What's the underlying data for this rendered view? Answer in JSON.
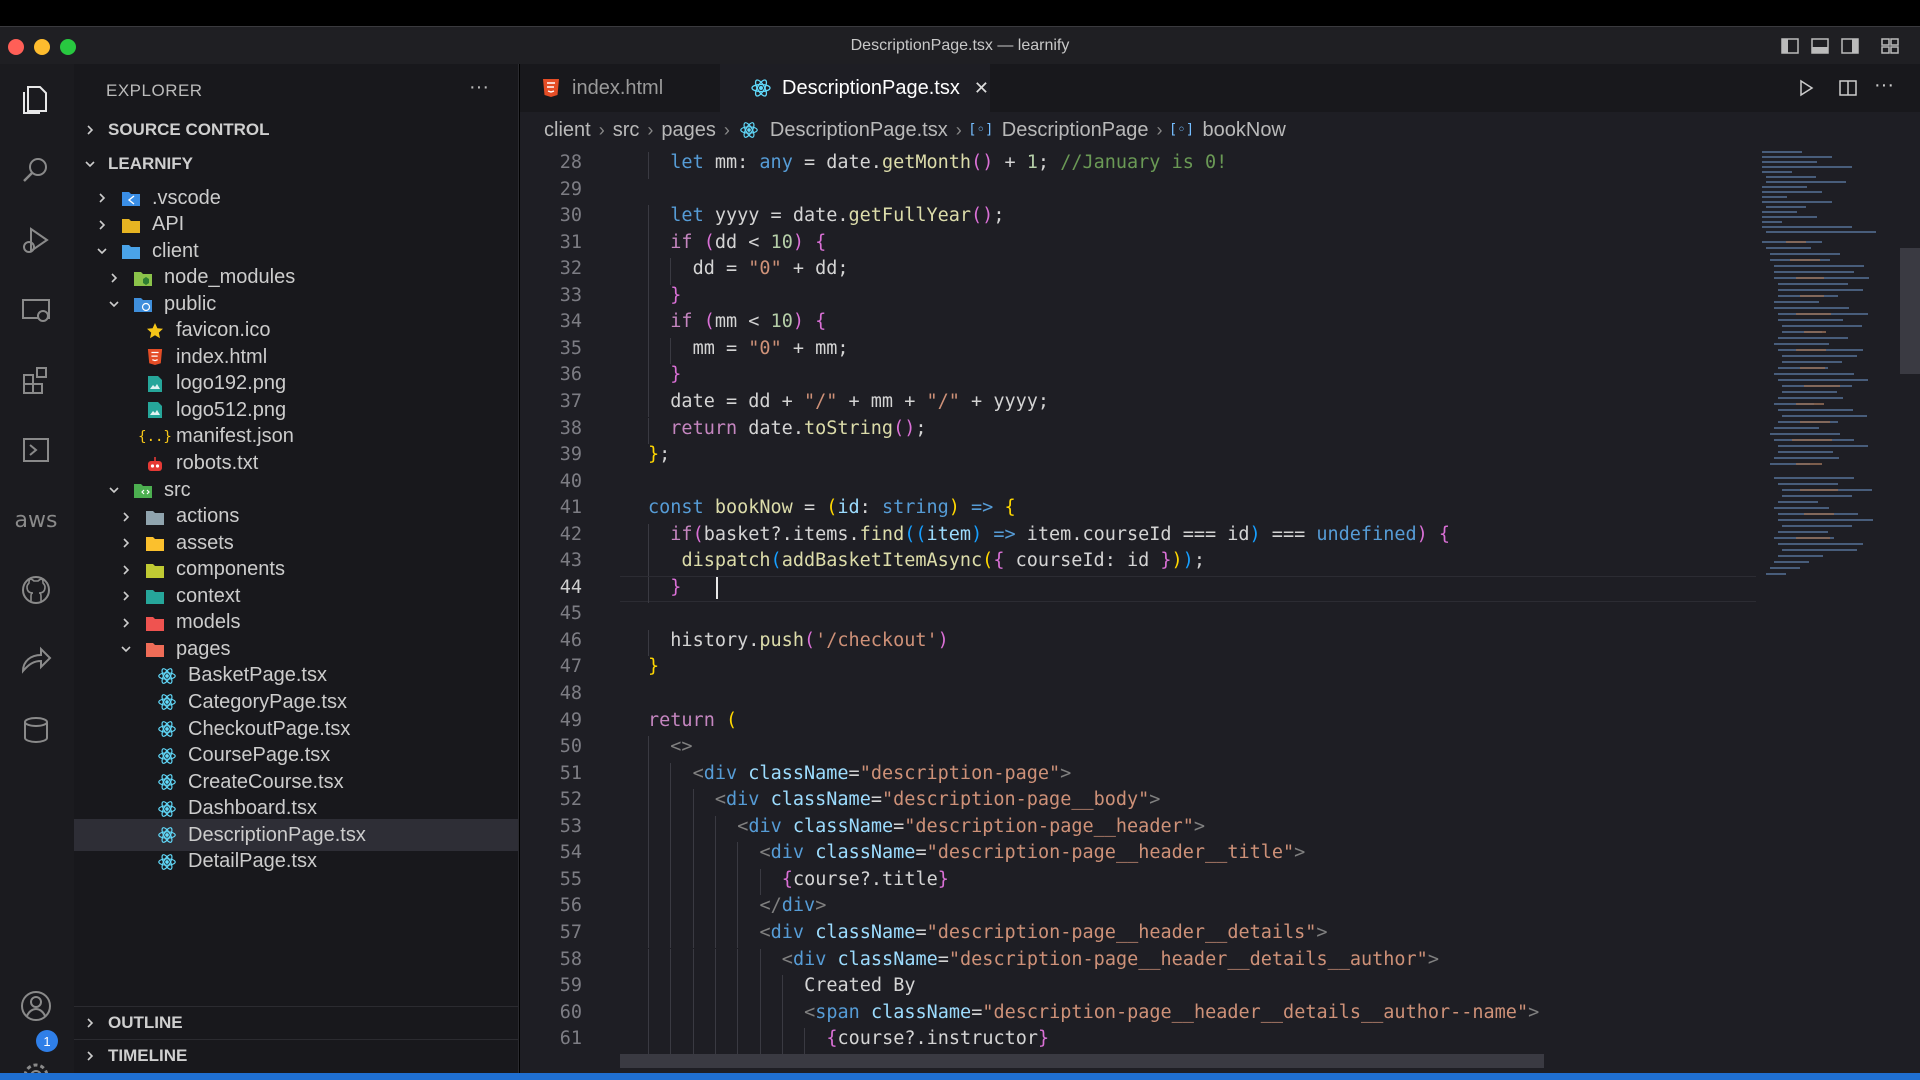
{
  "window": {
    "title": "DescriptionPage.tsx — learnify"
  },
  "colors": {
    "accent": "#1f6fd1",
    "close": "#ff5f57",
    "minimize": "#febc2e",
    "maximize": "#28c840"
  },
  "activity_bar": {
    "items": [
      "explorer-icon",
      "search-icon",
      "run-debug-icon",
      "remote-explorer-icon",
      "extensions-icon",
      "terminal-icon",
      "aws-icon",
      "github-icon",
      "live-share-icon",
      "database-icon"
    ],
    "aws_label": "aws",
    "accounts_badge": "1"
  },
  "sidebar": {
    "header": "EXPLORER",
    "more": "···",
    "sections": {
      "source_control": "SOURCE CONTROL",
      "project": "LEARNIFY",
      "outline": "OUTLINE",
      "timeline": "TIMELINE"
    },
    "tree": [
      {
        "label": ".vscode",
        "icon": "vscode-folder-icon",
        "expanded": false
      },
      {
        "label": "API",
        "icon": "folder-icon",
        "expanded": false
      },
      {
        "label": "client",
        "icon": "folder-open-icon",
        "expanded": true
      },
      {
        "label": "node_modules",
        "icon": "node-folder-icon",
        "expanded": false
      },
      {
        "label": "public",
        "icon": "public-folder-icon",
        "expanded": true
      },
      {
        "label": "favicon.ico",
        "icon": "star-icon"
      },
      {
        "label": "index.html",
        "icon": "html5-icon"
      },
      {
        "label": "logo192.png",
        "icon": "image-icon"
      },
      {
        "label": "logo512.png",
        "icon": "image-icon"
      },
      {
        "label": "manifest.json",
        "icon": "json-icon"
      },
      {
        "label": "robots.txt",
        "icon": "robot-icon"
      },
      {
        "label": "src",
        "icon": "src-folder-icon",
        "expanded": true
      },
      {
        "label": "actions",
        "icon": "folder-icon",
        "expanded": false
      },
      {
        "label": "assets",
        "icon": "folder-icon",
        "expanded": false
      },
      {
        "label": "components",
        "icon": "folder-icon",
        "expanded": false
      },
      {
        "label": "context",
        "icon": "folder-icon",
        "expanded": false
      },
      {
        "label": "models",
        "icon": "folder-icon",
        "expanded": false
      },
      {
        "label": "pages",
        "icon": "folder-open-icon",
        "expanded": true
      },
      {
        "label": "BasketPage.tsx",
        "icon": "react-icon"
      },
      {
        "label": "CategoryPage.tsx",
        "icon": "react-icon"
      },
      {
        "label": "CheckoutPage.tsx",
        "icon": "react-icon"
      },
      {
        "label": "CoursePage.tsx",
        "icon": "react-icon"
      },
      {
        "label": "CreateCourse.tsx",
        "icon": "react-icon"
      },
      {
        "label": "Dashboard.tsx",
        "icon": "react-icon"
      },
      {
        "label": "DescriptionPage.tsx",
        "icon": "react-icon",
        "selected": true
      },
      {
        "label": "DetailPage.tsx",
        "icon": "react-icon"
      }
    ]
  },
  "tabs": [
    {
      "label": "index.html",
      "icon": "html5-icon",
      "active": false
    },
    {
      "label": "DescriptionPage.tsx",
      "icon": "react-icon",
      "active": true,
      "close": "✕"
    }
  ],
  "breadcrumb": [
    "client",
    "src",
    "pages",
    "DescriptionPage.tsx",
    "DescriptionPage",
    "bookNow"
  ],
  "editor": {
    "current_line": 44,
    "lines": [
      {
        "n": "28",
        "indent": 1,
        "tokens": [
          [
            "k",
            "let"
          ],
          [
            "p",
            " mm: "
          ],
          [
            "t",
            "any"
          ],
          [
            "p",
            " = date."
          ],
          [
            "f",
            "getMonth"
          ],
          [
            "b2",
            "()"
          ],
          [
            "p",
            " + "
          ],
          [
            "n",
            "1"
          ],
          [
            "p",
            "; "
          ],
          [
            "c",
            "//January is 0!"
          ]
        ]
      },
      {
        "n": "29",
        "indent": 0,
        "tokens": []
      },
      {
        "n": "30",
        "indent": 1,
        "tokens": [
          [
            "k",
            "let"
          ],
          [
            "p",
            " yyyy = date."
          ],
          [
            "f",
            "getFullYear"
          ],
          [
            "b2",
            "()"
          ],
          [
            "p",
            ";"
          ]
        ]
      },
      {
        "n": "31",
        "indent": 1,
        "tokens": [
          [
            "kc",
            "if"
          ],
          [
            "p",
            " "
          ],
          [
            "b2",
            "("
          ],
          [
            "p",
            "dd < "
          ],
          [
            "n",
            "10"
          ],
          [
            "b2",
            ")"
          ],
          [
            "p",
            " "
          ],
          [
            "b2",
            "{"
          ]
        ]
      },
      {
        "n": "32",
        "indent": 2,
        "tokens": [
          [
            "p",
            "dd = "
          ],
          [
            "s",
            "\"0\""
          ],
          [
            "p",
            " + dd;"
          ]
        ]
      },
      {
        "n": "33",
        "indent": 1,
        "tokens": [
          [
            "b2",
            "}"
          ]
        ]
      },
      {
        "n": "34",
        "indent": 1,
        "tokens": [
          [
            "kc",
            "if"
          ],
          [
            "p",
            " "
          ],
          [
            "b2",
            "("
          ],
          [
            "p",
            "mm < "
          ],
          [
            "n",
            "10"
          ],
          [
            "b2",
            ")"
          ],
          [
            "p",
            " "
          ],
          [
            "b2",
            "{"
          ]
        ]
      },
      {
        "n": "35",
        "indent": 2,
        "tokens": [
          [
            "p",
            "mm = "
          ],
          [
            "s",
            "\"0\""
          ],
          [
            "p",
            " + mm;"
          ]
        ]
      },
      {
        "n": "36",
        "indent": 1,
        "tokens": [
          [
            "b2",
            "}"
          ]
        ]
      },
      {
        "n": "37",
        "indent": 1,
        "tokens": [
          [
            "p",
            "date = dd + "
          ],
          [
            "s",
            "\"/\""
          ],
          [
            "p",
            " + mm + "
          ],
          [
            "s",
            "\"/\""
          ],
          [
            "p",
            " + yyyy;"
          ]
        ]
      },
      {
        "n": "38",
        "indent": 1,
        "tokens": [
          [
            "kc",
            "return"
          ],
          [
            "p",
            " date."
          ],
          [
            "f",
            "toString"
          ],
          [
            "b2",
            "()"
          ],
          [
            "p",
            ";"
          ]
        ]
      },
      {
        "n": "39",
        "indent": 0,
        "tokens": [
          [
            "b1",
            "}"
          ],
          [
            "p",
            ";"
          ]
        ]
      },
      {
        "n": "40",
        "indent": 0,
        "tokens": []
      },
      {
        "n": "41",
        "indent": 0,
        "tokens": [
          [
            "k",
            "const"
          ],
          [
            "p",
            " "
          ],
          [
            "f",
            "bookNow"
          ],
          [
            "p",
            " = "
          ],
          [
            "b1",
            "("
          ],
          [
            "a",
            "id"
          ],
          [
            "p",
            ": "
          ],
          [
            "t",
            "string"
          ],
          [
            "b1",
            ")"
          ],
          [
            "p",
            " "
          ],
          [
            "k",
            "=>"
          ],
          [
            "p",
            " "
          ],
          [
            "b1",
            "{"
          ]
        ]
      },
      {
        "n": "42",
        "indent": 1,
        "tokens": [
          [
            "kc",
            "if"
          ],
          [
            "b2",
            "("
          ],
          [
            "p",
            "basket?.items."
          ],
          [
            "f",
            "find"
          ],
          [
            "b3",
            "(("
          ],
          [
            "a",
            "item"
          ],
          [
            "b3",
            ")"
          ],
          [
            "p",
            " "
          ],
          [
            "k",
            "=>"
          ],
          [
            "p",
            " item.courseId === id"
          ],
          [
            "b3",
            ")"
          ],
          [
            "p",
            " === "
          ],
          [
            "k",
            "undefined"
          ],
          [
            "b2",
            ")"
          ],
          [
            "p",
            " "
          ],
          [
            "b2",
            "{"
          ]
        ]
      },
      {
        "n": "43",
        "indent": 1,
        "tokens": [
          [
            "p",
            " "
          ],
          [
            "f",
            "dispatch"
          ],
          [
            "b3",
            "("
          ],
          [
            "f",
            "addBasketItemAsync"
          ],
          [
            "b1",
            "("
          ],
          [
            "b2",
            "{"
          ],
          [
            "p",
            " courseId: id "
          ],
          [
            "b2",
            "}"
          ],
          [
            "b1",
            ")"
          ],
          [
            "b3",
            ")"
          ],
          [
            "p",
            ";"
          ]
        ]
      },
      {
        "n": "44",
        "indent": 1,
        "tokens": [
          [
            "b2",
            "}"
          ]
        ]
      },
      {
        "n": "45",
        "indent": 0,
        "tokens": []
      },
      {
        "n": "46",
        "indent": 1,
        "tokens": [
          [
            "p",
            "history."
          ],
          [
            "f",
            "push"
          ],
          [
            "b2",
            "("
          ],
          [
            "s",
            "'/checkout'"
          ],
          [
            "b2",
            ")"
          ]
        ]
      },
      {
        "n": "47",
        "indent": 0,
        "tokens": [
          [
            "b1",
            "}"
          ]
        ]
      },
      {
        "n": "48",
        "indent": 0,
        "tokens": []
      },
      {
        "n": "49",
        "indent": 0,
        "tokens": [
          [
            "kc",
            "return"
          ],
          [
            "p",
            " "
          ],
          [
            "b1",
            "("
          ]
        ]
      },
      {
        "n": "50",
        "indent": 1,
        "tokens": [
          [
            "tbr",
            "<>"
          ]
        ]
      },
      {
        "n": "51",
        "indent": 2,
        "tokens": [
          [
            "tbr",
            "<"
          ],
          [
            "tag",
            "div"
          ],
          [
            "p",
            " "
          ],
          [
            "a",
            "className"
          ],
          [
            "p",
            "="
          ],
          [
            "s",
            "\"description-page\""
          ],
          [
            "tbr",
            ">"
          ]
        ]
      },
      {
        "n": "52",
        "indent": 3,
        "tokens": [
          [
            "tbr",
            "<"
          ],
          [
            "tag",
            "div"
          ],
          [
            "p",
            " "
          ],
          [
            "a",
            "className"
          ],
          [
            "p",
            "="
          ],
          [
            "s",
            "\"description-page__body\""
          ],
          [
            "tbr",
            ">"
          ]
        ]
      },
      {
        "n": "53",
        "indent": 4,
        "tokens": [
          [
            "tbr",
            "<"
          ],
          [
            "tag",
            "div"
          ],
          [
            "p",
            " "
          ],
          [
            "a",
            "className"
          ],
          [
            "p",
            "="
          ],
          [
            "s",
            "\"description-page__header\""
          ],
          [
            "tbr",
            ">"
          ]
        ]
      },
      {
        "n": "54",
        "indent": 5,
        "tokens": [
          [
            "tbr",
            "<"
          ],
          [
            "tag",
            "div"
          ],
          [
            "p",
            " "
          ],
          [
            "a",
            "className"
          ],
          [
            "p",
            "="
          ],
          [
            "s",
            "\"description-page__header__title\""
          ],
          [
            "tbr",
            ">"
          ]
        ]
      },
      {
        "n": "55",
        "indent": 6,
        "tokens": [
          [
            "b2",
            "{"
          ],
          [
            "p",
            "course?.title"
          ],
          [
            "b2",
            "}"
          ]
        ]
      },
      {
        "n": "56",
        "indent": 5,
        "tokens": [
          [
            "tbr",
            "</"
          ],
          [
            "tag",
            "div"
          ],
          [
            "tbr",
            ">"
          ]
        ]
      },
      {
        "n": "57",
        "indent": 5,
        "tokens": [
          [
            "tbr",
            "<"
          ],
          [
            "tag",
            "div"
          ],
          [
            "p",
            " "
          ],
          [
            "a",
            "className"
          ],
          [
            "p",
            "="
          ],
          [
            "s",
            "\"description-page__header__details\""
          ],
          [
            "tbr",
            ">"
          ]
        ]
      },
      {
        "n": "58",
        "indent": 6,
        "tokens": [
          [
            "tbr",
            "<"
          ],
          [
            "tag",
            "div"
          ],
          [
            "p",
            " "
          ],
          [
            "a",
            "className"
          ],
          [
            "p",
            "="
          ],
          [
            "s",
            "\"description-page__header__details__author\""
          ],
          [
            "tbr",
            ">"
          ]
        ]
      },
      {
        "n": "59",
        "indent": 7,
        "tokens": [
          [
            "p",
            "Created By"
          ]
        ]
      },
      {
        "n": "60",
        "indent": 7,
        "tokens": [
          [
            "tbr",
            "<"
          ],
          [
            "tag",
            "span"
          ],
          [
            "p",
            " "
          ],
          [
            "a",
            "className"
          ],
          [
            "p",
            "="
          ],
          [
            "s",
            "\"description-page__header__details__author--name\""
          ],
          [
            "tbr",
            ">"
          ]
        ]
      },
      {
        "n": "61",
        "indent": 8,
        "tokens": [
          [
            "b2",
            "{"
          ],
          [
            "p",
            "course?.instructor"
          ],
          [
            "b2",
            "}"
          ]
        ]
      }
    ]
  }
}
